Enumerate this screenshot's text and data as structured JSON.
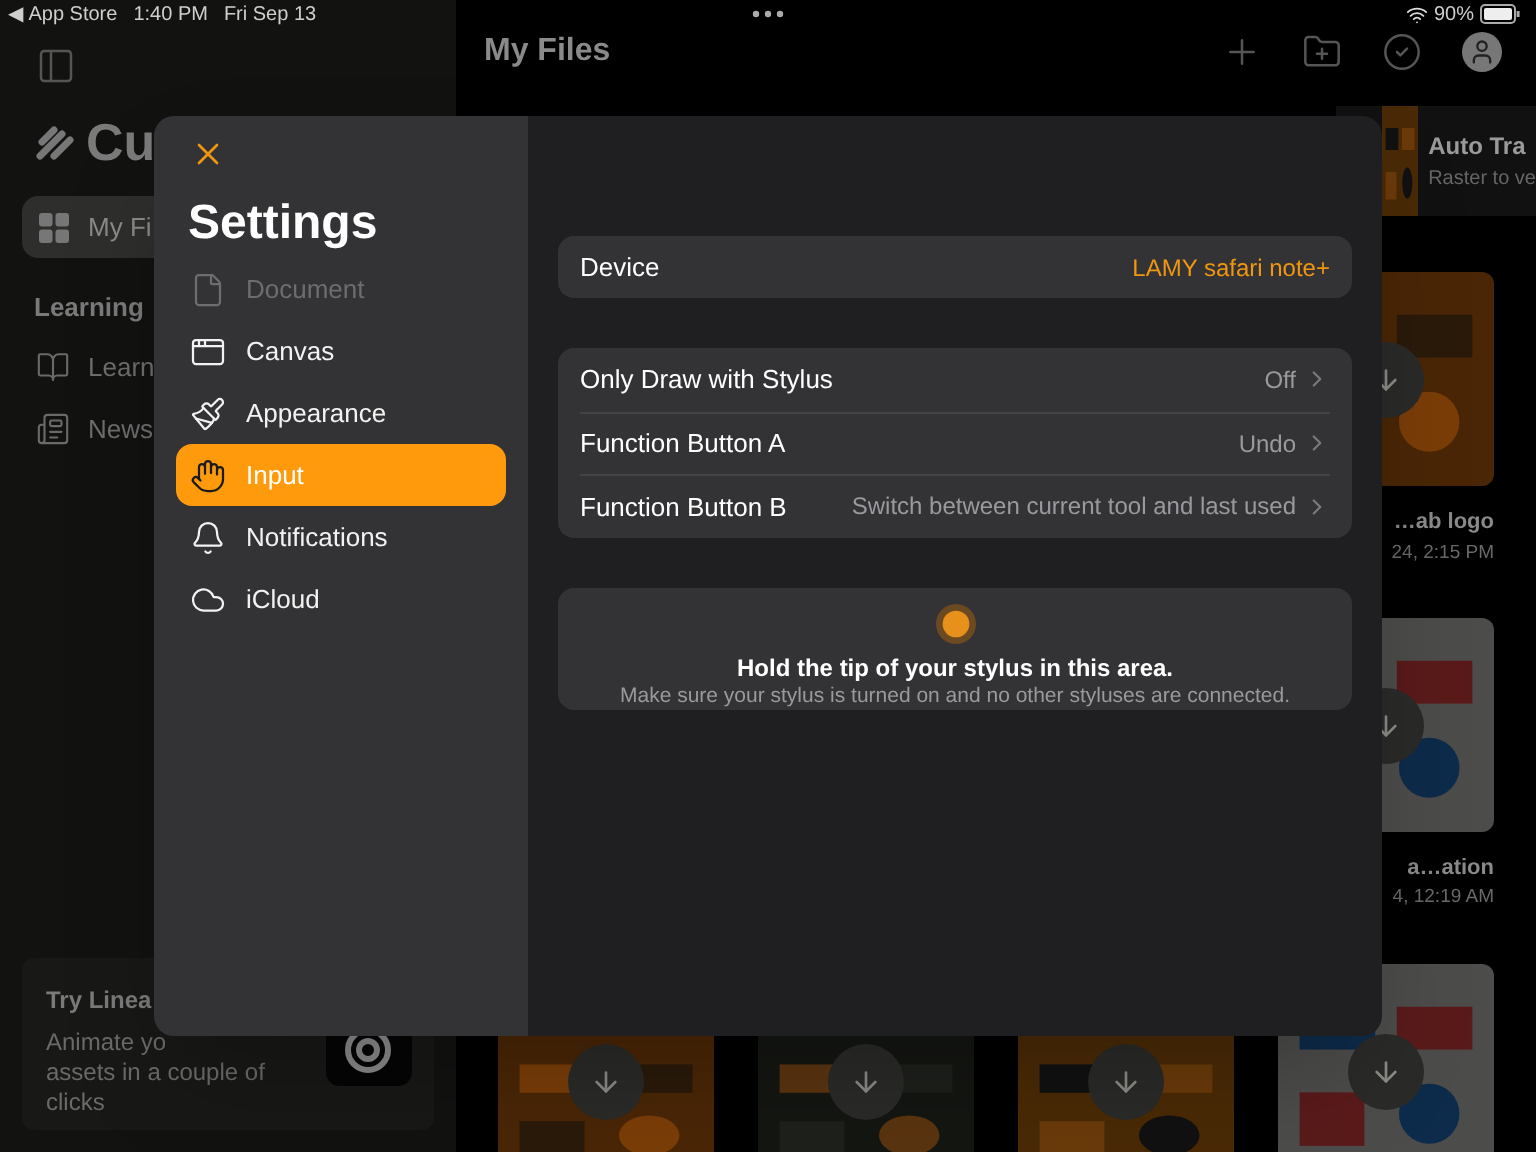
{
  "status_bar": {
    "back": "◀ App Store",
    "time": "1:40 PM",
    "date": "Fri Sep 13",
    "battery": "90%"
  },
  "sidebar": {
    "logo": "Cu",
    "items": [
      {
        "label": "My Fi",
        "selected": true
      }
    ],
    "section": "Learning",
    "links": [
      {
        "label": "Learn",
        "kind": "book"
      },
      {
        "label": "News",
        "kind": "news"
      }
    ],
    "promo": {
      "title": "Try Linea",
      "lines": [
        "Animate yo",
        "assets in a couple of",
        "clicks"
      ]
    }
  },
  "header": {
    "title": "My Files"
  },
  "files": {
    "featured": {
      "title": "Auto Tra",
      "subtitle": "Raster to ve"
    },
    "items": [
      {
        "name": "…ab logo",
        "date": "24, 2:15 PM"
      },
      {
        "name": "a…ation",
        "date": "4, 12:19 AM"
      }
    ]
  },
  "settings": {
    "title": "Settings",
    "nav": [
      {
        "label": "Document",
        "kind": "document",
        "selected": false,
        "disabled": true
      },
      {
        "label": "Canvas",
        "kind": "canvas",
        "selected": false,
        "disabled": false
      },
      {
        "label": "Appearance",
        "kind": "appearance",
        "selected": false,
        "disabled": false
      },
      {
        "label": "Input",
        "kind": "input",
        "selected": true,
        "disabled": false
      },
      {
        "label": "Notifications",
        "kind": "notifications",
        "selected": false,
        "disabled": false
      },
      {
        "label": "iCloud",
        "kind": "icloud",
        "selected": false,
        "disabled": false
      }
    ],
    "device": {
      "label": "Device",
      "value": "LAMY safari note+"
    },
    "options": [
      {
        "label": "Only Draw with Stylus",
        "value": "Off"
      },
      {
        "label": "Function Button A",
        "value": "Undo"
      },
      {
        "label": "Function Button B",
        "value": "Switch between current tool and last used"
      }
    ],
    "test_area": {
      "title": "Hold the tip of your stylus in this area.",
      "hint": "Make sure your stylus is turned on and no other styluses are connected."
    }
  }
}
